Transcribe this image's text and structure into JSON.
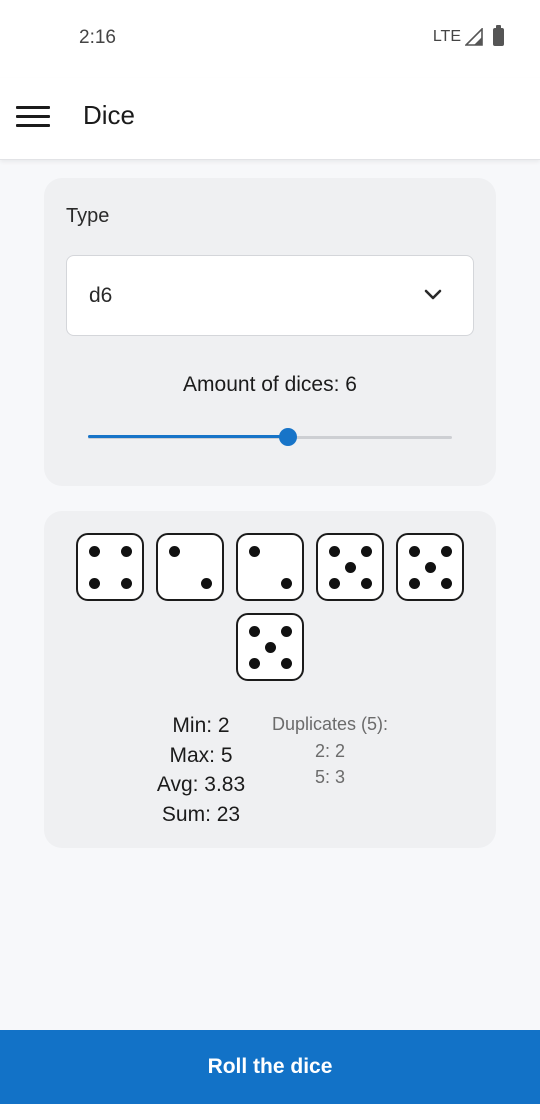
{
  "status_bar": {
    "time": "2:16",
    "network": "LTE",
    "signal_icon": "signal-icon",
    "battery_icon": "battery-icon"
  },
  "app_bar": {
    "menu_icon": "hamburger-menu-icon",
    "title": "Dice"
  },
  "settings": {
    "type_label": "Type",
    "type_value": "d6",
    "type_dropdown_icon": "chevron-down-icon",
    "amount_label": "Amount of dices: 6",
    "amount_value": 6,
    "slider_fraction": 0.55
  },
  "dice": {
    "values": [
      4,
      2,
      2,
      5,
      5,
      5
    ]
  },
  "stats": {
    "min": "Min: 2",
    "max": "Max: 5",
    "avg": "Avg: 3.83",
    "sum": "Sum: 23"
  },
  "duplicates": {
    "title": "Duplicates (5):",
    "items": [
      "2: 2",
      "5: 3"
    ]
  },
  "actions": {
    "roll_label": "Roll the dice"
  },
  "colors": {
    "accent": "#1272c7",
    "card_background": "#eff0f2",
    "page_background": "#f7f8fa"
  }
}
